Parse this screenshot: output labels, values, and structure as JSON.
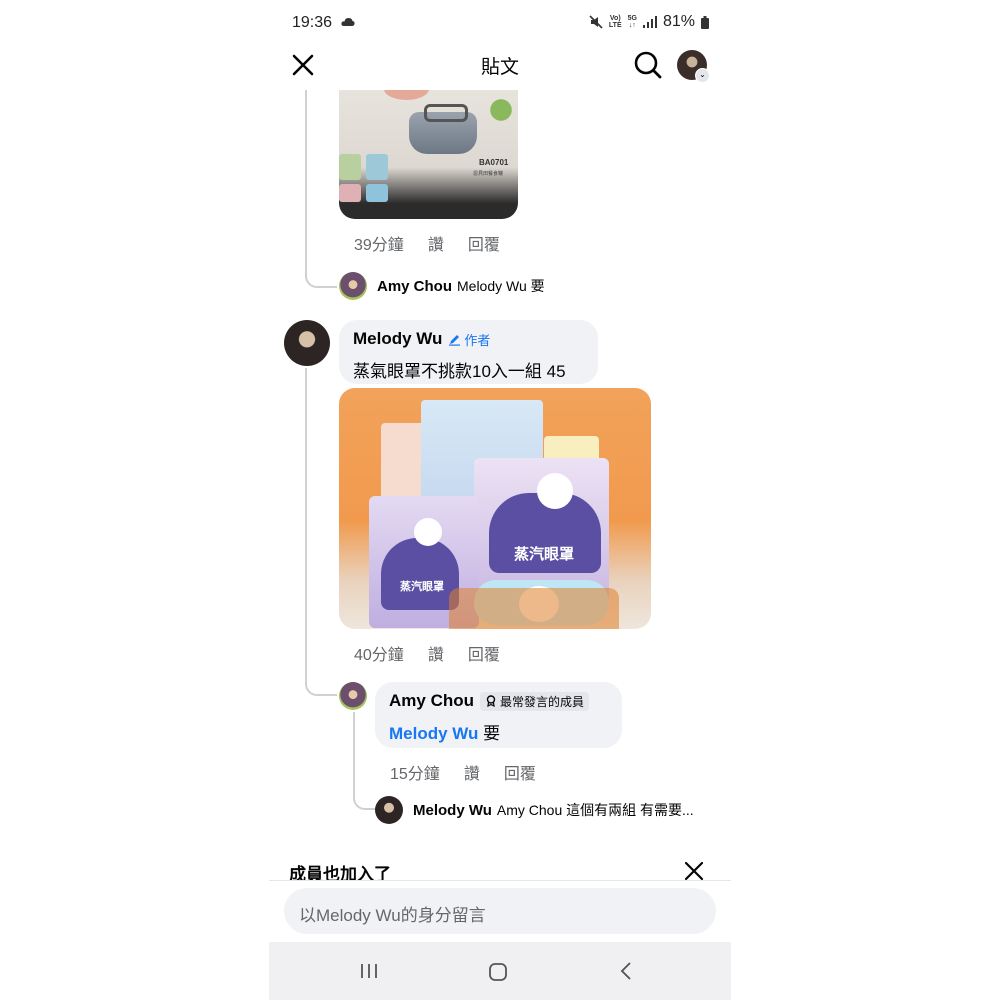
{
  "status_bar": {
    "time": "19:36",
    "volte_top": "Vo)",
    "volte_bottom": "LTE",
    "net_top": "5G",
    "net_bottom": "↓↑",
    "battery": "81%"
  },
  "header": {
    "title": "貼文"
  },
  "post1": {
    "image_label": "BA0701",
    "image_sublabel": "恩貝田餐食罐",
    "meta": {
      "time": "39分鐘",
      "like": "讚",
      "reply": "回覆"
    },
    "collapsed_reply": {
      "author": "Amy Chou",
      "preview": "Melody Wu 要"
    }
  },
  "comment": {
    "author": "Melody Wu",
    "badge": "作者",
    "text": "蒸氣眼罩不挑款10入一組 45",
    "image_text": "蒸汽眼罩",
    "meta": {
      "time": "40分鐘",
      "like": "讚",
      "reply": "回覆"
    }
  },
  "reply": {
    "author": "Amy Chou",
    "badge": "最常發言的成員",
    "mention": "Melody Wu",
    "text": "要",
    "meta": {
      "time": "15分鐘",
      "like": "讚",
      "reply": "回覆"
    },
    "collapsed_reply": {
      "author": "Melody Wu",
      "preview": "Amy Chou 這個有兩組 有需要..."
    }
  },
  "suggestions": {
    "title": "成員也加入了"
  },
  "composer": {
    "placeholder": "以Melody Wu的身分留言"
  },
  "colors": {
    "link": "#1877f2",
    "bubble": "#f0f2f5",
    "meta": "#65676b"
  }
}
